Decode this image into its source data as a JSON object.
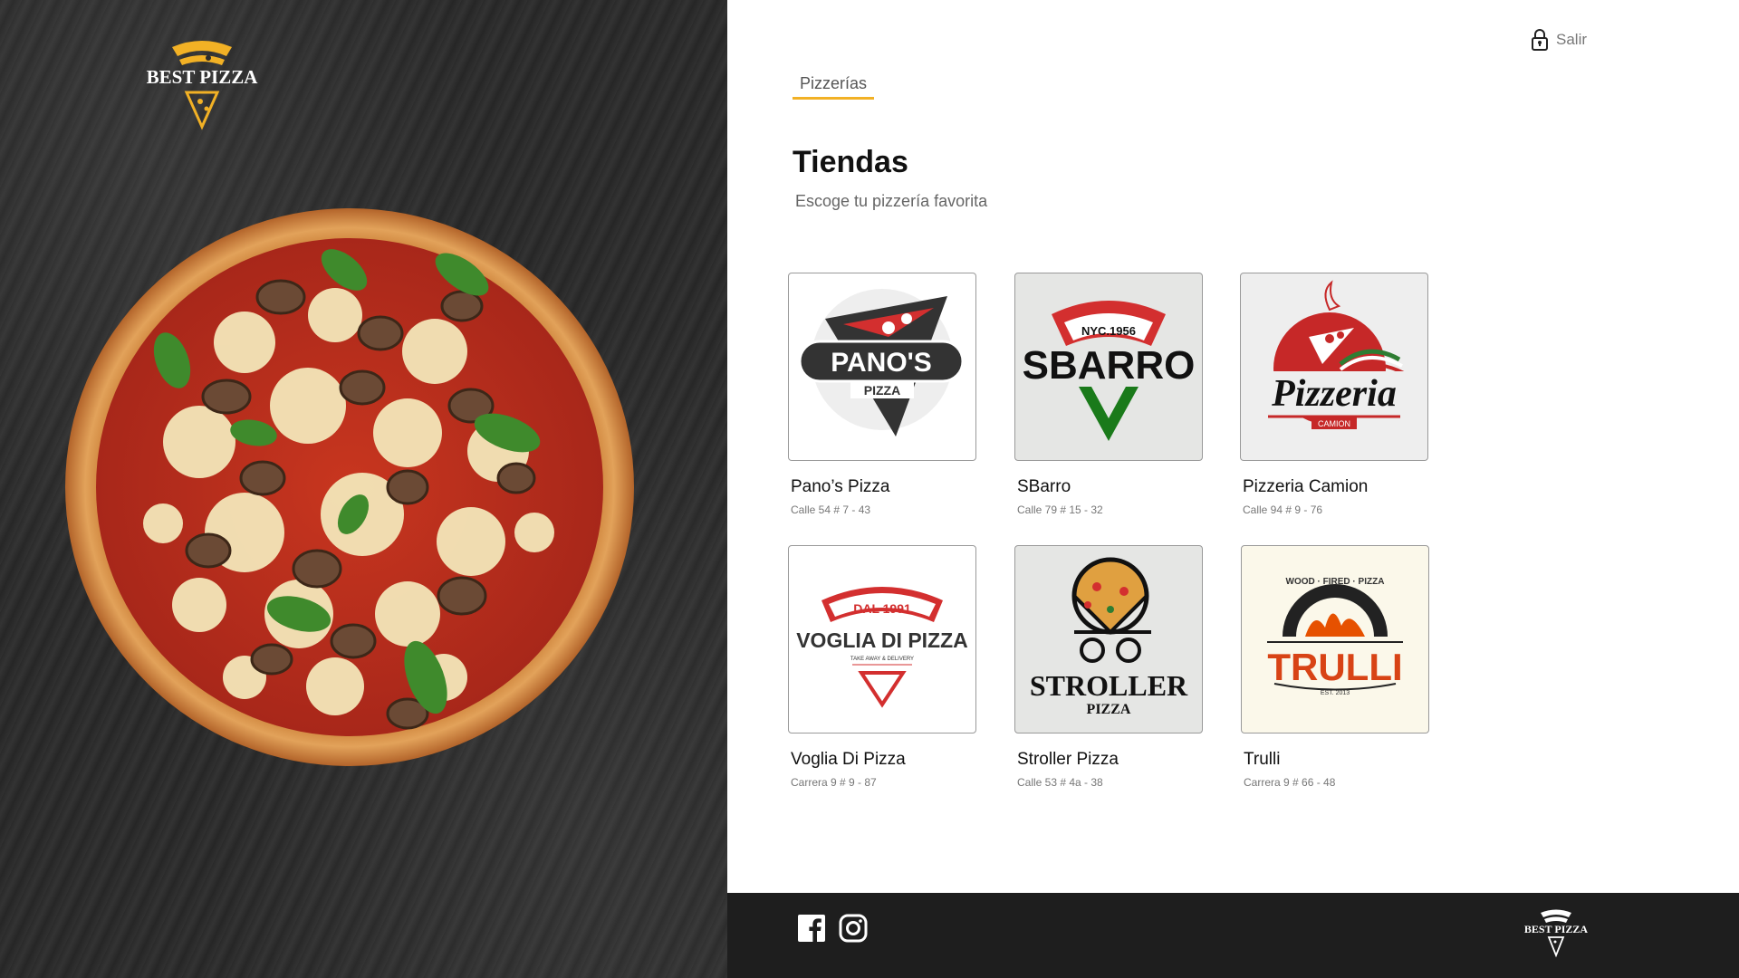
{
  "brand": {
    "logo_text": "BEST PIZZA"
  },
  "header": {
    "logout_label": "Salir",
    "logout_icon": "lock-icon"
  },
  "tabs": [
    {
      "label": "Pizzerías",
      "active": true
    }
  ],
  "page": {
    "title": "Tiendas",
    "subtitle": "Escoge tu pizzería favorita"
  },
  "stores": [
    {
      "name": "Pano’s Pizza",
      "address": "Calle 54 # 7 - 43",
      "logo_text": "PANO'S",
      "logo_sub": "PIZZA"
    },
    {
      "name": "SBarro",
      "address": "Calle 79  # 15 - 32",
      "logo_text": "SBARRO",
      "logo_sub": "NYC.1956"
    },
    {
      "name": "Pizzeria Camion",
      "address": "Calle 94 # 9 - 76",
      "logo_text": "Pizzeria",
      "logo_sub": "CAMION"
    },
    {
      "name": "Voglia Di Pizza",
      "address": "Carrera 9 # 9 - 87",
      "logo_text": "VOGLIA DI PIZZA",
      "logo_sub": "DAL 1991",
      "logo_tag": "TAKE AWAY & DELIVERY"
    },
    {
      "name": "Stroller Pizza",
      "address": "Calle 53 # 4a - 38",
      "logo_text": "STROLLER",
      "logo_sub": "PIZZA"
    },
    {
      "name": "Trulli",
      "address": "Carrera 9 # 66 - 48",
      "logo_text": "TRULLI",
      "logo_sub": "WOOD · FIRED · PIZZA",
      "logo_tag": "EST. 2013"
    }
  ],
  "footer": {
    "social": [
      "facebook-icon",
      "instagram-icon"
    ],
    "logo_text": "BEST PIZZA"
  },
  "colors": {
    "accent": "#f2b125",
    "footer_bg": "#1e1e1e",
    "red": "#d32f2f",
    "green": "#1a7a1a"
  }
}
